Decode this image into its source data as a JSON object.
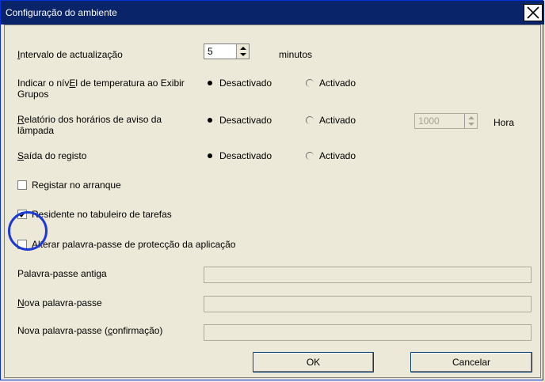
{
  "window": {
    "title": "Configuração do ambiente",
    "close_label": "X"
  },
  "update_interval": {
    "label_u": "I",
    "label_rest": "ntervalo de actualização",
    "value": "5",
    "unit": "minutos"
  },
  "temp_level": {
    "label_line1_a": "Indicar o nív",
    "label_line1_u": "E",
    "label_line1_b": "l de temperatura ao Exibir",
    "label_line2": "Grupos",
    "option_off": "Desactivado",
    "option_on": "Activado",
    "selected": "off"
  },
  "lamp_report": {
    "label_line1_u": "R",
    "label_line1_rest": "elatório dos horários de aviso da",
    "label_line2": "lâmpada",
    "option_off": "Desactivado",
    "option_on": "Activado",
    "selected": "off",
    "hours_value": "1000",
    "hours_unit": "Hora"
  },
  "log_output": {
    "label_u": "S",
    "label_rest": "aída do registo",
    "option_off": "Desactivado",
    "option_on": "Activado",
    "selected": "off"
  },
  "checkboxes": {
    "register_startup": {
      "label": "Registar no arranque",
      "checked": false
    },
    "tray_resident": {
      "label": "Residente no tabuleiro de tarefas",
      "checked": true
    },
    "change_password": {
      "label": "Alterar palavra-passe de protecção da aplicação",
      "checked": false
    }
  },
  "password": {
    "old_label": "Palavra-passe antiga",
    "new_label_u": "N",
    "new_label_rest": "ova palavra-passe",
    "confirm_label_a": "Nova palavra-passe (",
    "confirm_label_u": "c",
    "confirm_label_b": "onfirmação)"
  },
  "buttons": {
    "ok": "OK",
    "cancel": "Cancelar"
  },
  "colors": {
    "titlebar": "#0a246a",
    "dialog_bg": "#ece9d8",
    "highlight_circle": "#1c39d6"
  }
}
